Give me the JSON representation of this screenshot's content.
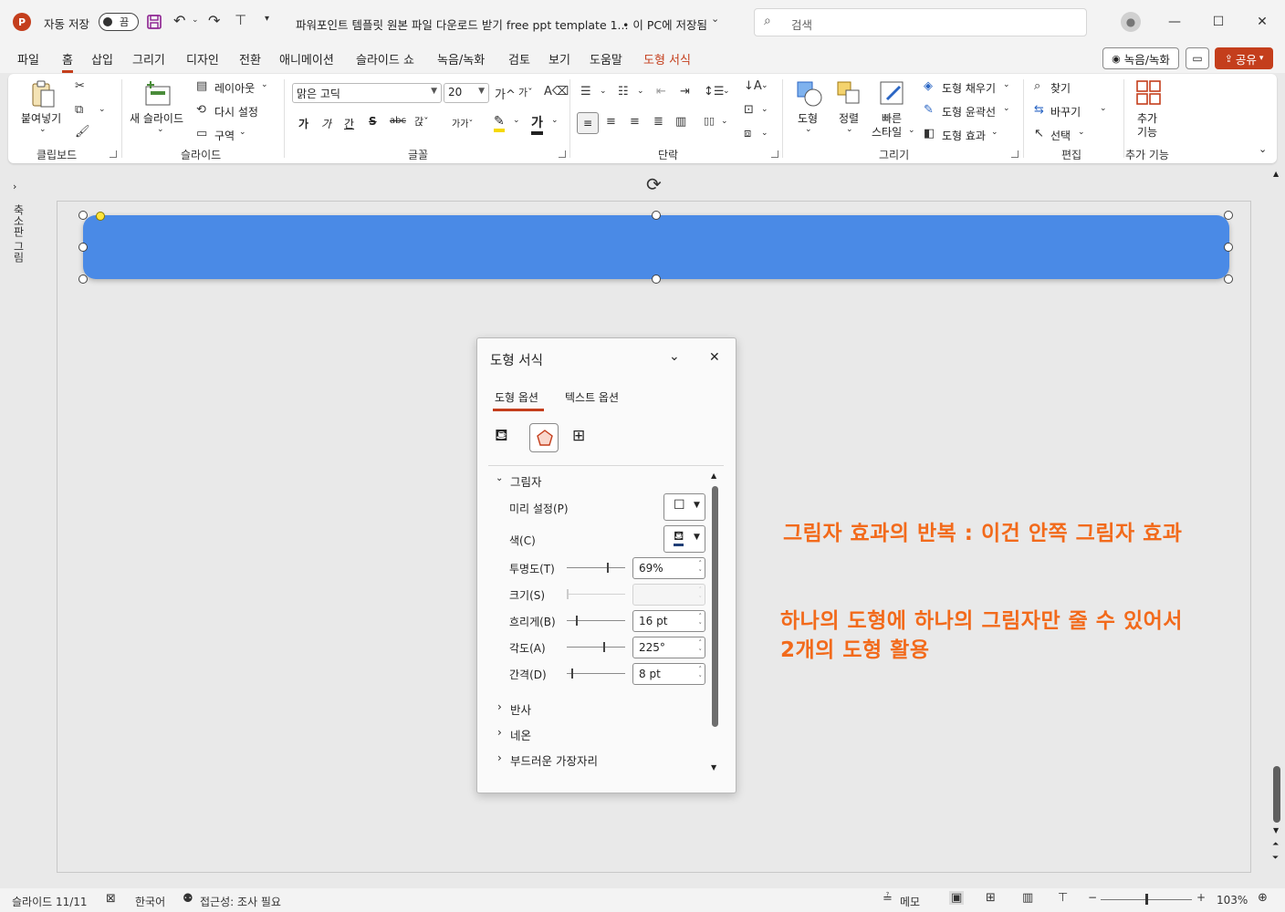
{
  "titlebar": {
    "autosave_label": "자동 저장",
    "autosave_state": "끔",
    "doc_title": "파워포인트 템플릿 원본 파일 다운로드 받기 free ppt template 1...",
    "save_status": "• 이 PC에 저장됨",
    "search_placeholder": "검색"
  },
  "menu": {
    "tabs": [
      "파일",
      "홈",
      "삽입",
      "그리기",
      "디자인",
      "전환",
      "애니메이션",
      "슬라이드 쇼",
      "녹음/녹화",
      "검토",
      "보기",
      "도움말",
      "도형 서식"
    ],
    "active": "홈",
    "record_label": "녹음/녹화",
    "share_label": "공유"
  },
  "ribbon": {
    "clipboard": {
      "paste": "붙여넣기",
      "label": "클립보드"
    },
    "slides": {
      "new_slide": "새 슬라이드",
      "layout": "레이아웃",
      "reset": "다시 설정",
      "section": "구역",
      "label": "슬라이드"
    },
    "font": {
      "font_name": "맑은 고딕",
      "font_size": "20",
      "label": "글꼴"
    },
    "paragraph": {
      "label": "단락"
    },
    "drawing": {
      "shapes": "도형",
      "arrange": "정렬",
      "quick_styles_1": "빠른",
      "quick_styles_2": "스타일",
      "fill": "도형 채우기",
      "outline": "도형 윤곽선",
      "effects": "도형 효과",
      "label": "그리기"
    },
    "editing": {
      "find": "찾기",
      "replace": "바꾸기",
      "select": "선택",
      "label": "편집"
    },
    "addins": {
      "btn_1": "추가",
      "btn_2": "기능",
      "label": "추가 기능"
    }
  },
  "leftpane": {
    "label": "축소판 그림"
  },
  "annotations": {
    "line1": "그림자 효과의 반복 : 이건 안쪽 그림자 효과",
    "line2": "하나의 도형에 하나의 그림자만 줄 수 있어서",
    "line3": "2개의 도형 활용"
  },
  "format_pane": {
    "title": "도형 서식",
    "tab_shape": "도형 옵션",
    "tab_text": "텍스트 옵션",
    "section_shadow": "그림자",
    "preset_label": "미리 설정(P)",
    "color_label": "색(C)",
    "transparency_label": "투명도(T)",
    "transparency_value": "69%",
    "size_label": "크기(S)",
    "size_value": "",
    "blur_label": "흐리게(B)",
    "blur_value": "16 pt",
    "angle_label": "각도(A)",
    "angle_value": "225°",
    "distance_label": "간격(D)",
    "distance_value": "8 pt",
    "section_reflection": "반사",
    "section_glow": "네온",
    "section_soft_edges": "부드러운 가장자리",
    "slider_levels": {
      "transparency": 0.69,
      "blur": 0.16,
      "angle": 0.625,
      "distance": 0.08
    }
  },
  "statusbar": {
    "slide_info": "슬라이드 11/11",
    "language": "한국어",
    "accessibility": "접근성: 조사 필요",
    "notes": "메모",
    "zoom": "103%"
  },
  "colors": {
    "accent": "#c43e1c",
    "shape_fill": "#4a8ae6",
    "annotation": "#f26a1b"
  }
}
